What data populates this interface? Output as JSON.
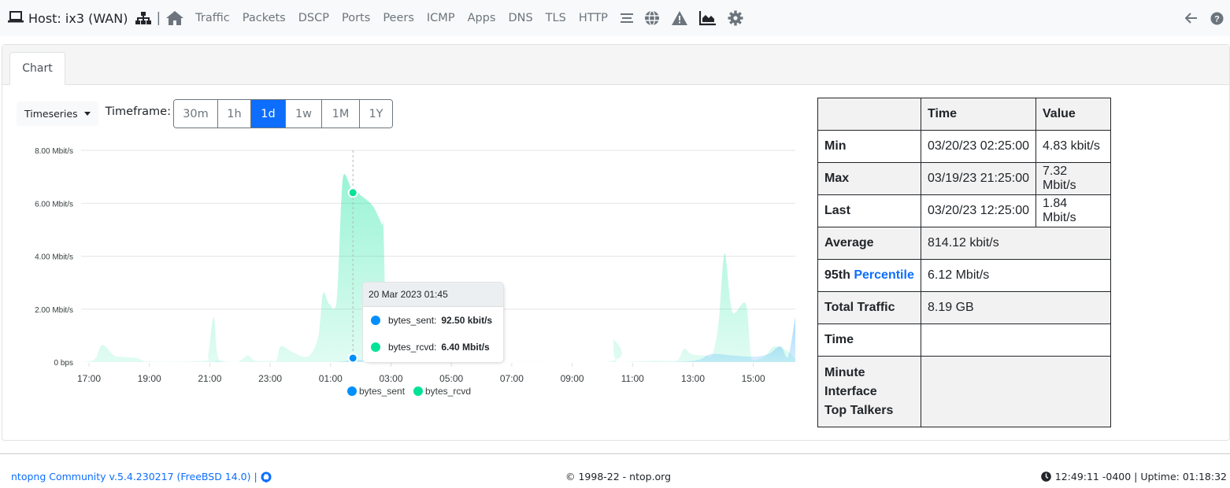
{
  "topnav": {
    "host_label": "Host: ix3 (WAN)",
    "separator": "|",
    "links": [
      "Traffic",
      "Packets",
      "DSCP",
      "Ports",
      "Peers",
      "ICMP",
      "Apps",
      "DNS",
      "TLS",
      "HTTP"
    ],
    "icons": [
      "laptop-icon",
      "network-tree-icon",
      "home-icon",
      "list-icon",
      "globe-icon",
      "warning-icon",
      "area-chart-icon",
      "gear-icon",
      "back-arrow-icon",
      "help-icon"
    ]
  },
  "tabs": [
    {
      "label": "Chart",
      "active": true
    }
  ],
  "toolbar": {
    "dropdown_label": "Timeseries",
    "timeframe_label": "Timeframe:",
    "timeframes": [
      "30m",
      "1h",
      "1d",
      "1w",
      "1M",
      "1Y"
    ],
    "active_timeframe": "1d"
  },
  "colors": {
    "accent": "#0d6efd",
    "bytes_sent": "#008ffb",
    "bytes_rcvd": "#00e396"
  },
  "chart_data": {
    "type": "area",
    "title": "",
    "xlabel": "",
    "ylabel": "",
    "x_unit": "hours since 17:00 (19 Mar 2023)",
    "x_range": [
      -0.27,
      23.4
    ],
    "ylim": [
      0,
      8
    ],
    "y_unit": "Mbit/s",
    "y_ticks": [
      "0 bps",
      "2.00 Mbit/s",
      "4.00 Mbit/s",
      "6.00 Mbit/s",
      "8.00 Mbit/s"
    ],
    "x_ticks": [
      "17:00",
      "19:00",
      "21:00",
      "23:00",
      "01:00",
      "03:00",
      "05:00",
      "07:00",
      "09:00",
      "11:00",
      "13:00",
      "15:00"
    ],
    "grid": true,
    "legend_position": "bottom-center",
    "series": [
      {
        "name": "bytes_sent",
        "x": [
          -0.27,
          2.0,
          4.0,
          4.3,
          4.6,
          8.0,
          8.74,
          9.5,
          10.0,
          18.0,
          20.0,
          20.6,
          21.3,
          22.0,
          22.5,
          22.9,
          23.15,
          23.4
        ],
        "values": [
          0,
          0,
          0,
          0.05,
          0,
          0,
          0.09,
          0.05,
          0,
          0,
          0.05,
          0.3,
          0.25,
          0.2,
          0.3,
          0.6,
          0.2,
          1.7
        ]
      },
      {
        "name": "bytes_rcvd",
        "x": [
          -0.27,
          0.18,
          0.44,
          0.83,
          1.1,
          1.6,
          2.0,
          3.8,
          3.95,
          4.13,
          4.3,
          4.9,
          5.25,
          5.5,
          6.0,
          6.2,
          6.35,
          6.7,
          7.1,
          7.35,
          7.6,
          7.75,
          7.95,
          8.2,
          8.35,
          8.45,
          8.74,
          8.9,
          9.0,
          9.4,
          9.7,
          9.75,
          9.85,
          10.0,
          17.1,
          17.35,
          17.5,
          18.7,
          19.45,
          19.7,
          19.95,
          20.4,
          20.65,
          20.85,
          21.05,
          21.3,
          21.75,
          21.95,
          22.35,
          22.7,
          23.15,
          23.4
        ],
        "values": [
          0,
          0.1,
          0.65,
          0.25,
          0.2,
          0.15,
          0.02,
          0.05,
          0.3,
          1.7,
          0.1,
          0,
          0.25,
          0.05,
          0.05,
          0.05,
          0.6,
          0.4,
          0.2,
          0.3,
          1.0,
          2.6,
          2.2,
          2.3,
          6.0,
          7.1,
          6.4,
          6.4,
          6.3,
          5.9,
          5.2,
          5.1,
          1.0,
          0.1,
          0,
          0.9,
          0,
          0.05,
          0.05,
          0.5,
          0.3,
          0.25,
          0.3,
          1.5,
          4.1,
          1.9,
          2.2,
          0.1,
          0.2,
          0.6,
          0.4,
          0.1
        ]
      }
    ],
    "hover": {
      "x": 8.74
    }
  },
  "tooltip": {
    "title": "20 Mar 2023 01:45",
    "rows": [
      {
        "name": "bytes_sent:",
        "value": "92.50 kbit/s"
      },
      {
        "name": "bytes_rcvd:",
        "value": "6.40 Mbit/s"
      }
    ]
  },
  "stats": {
    "headers": [
      "",
      "Time",
      "Value"
    ],
    "min": {
      "label": "Min",
      "time": "03/20/23 02:25:00",
      "value": "4.83 kbit/s"
    },
    "max": {
      "label": "Max",
      "time": "03/19/23 21:25:00",
      "value": "7.32 Mbit/s"
    },
    "last": {
      "label": "Last",
      "time": "03/20/23 12:25:00",
      "value": "1.84 Mbit/s"
    },
    "average": {
      "label": "Average",
      "value": "814.12 kbit/s"
    },
    "percentile": {
      "label_prefix": "95th",
      "label_link": "Percentile",
      "value": "6.12 Mbit/s"
    },
    "total": {
      "label": "Total Traffic",
      "value": "8.19 GB"
    },
    "time": {
      "label": "Time",
      "value": ""
    },
    "top_talkers": {
      "line1": "Minute",
      "line2": "Interface",
      "line3": "Top Talkers",
      "value": ""
    }
  },
  "footer": {
    "version": "ntopng Community v.5.4.230217 (FreeBSD 14.0) |",
    "copyright": "© 1998-22 - ntop.org",
    "clock": "12:49:11 -0400 | Uptime: 01:18:32"
  }
}
